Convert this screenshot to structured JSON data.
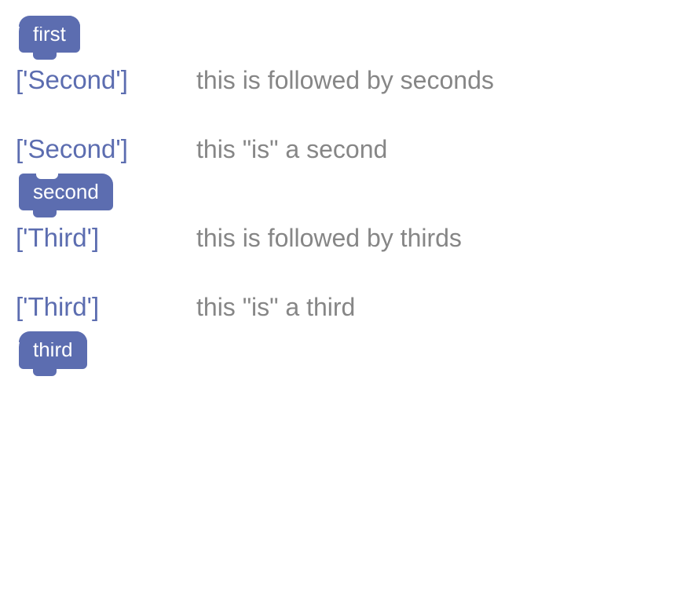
{
  "groups": [
    {
      "block_label": "first",
      "block_style": "hat round",
      "tokens": "['Second']",
      "desc": "this is followed by seconds"
    },
    {
      "intro_tokens": "['Second']",
      "intro_desc": "this \"is\" a second",
      "block_label": "second",
      "block_style": "notch-top",
      "tokens": "['Third']",
      "desc": "this is followed by thirds"
    },
    {
      "intro_tokens": "['Third']",
      "intro_desc": "this \"is\" a third",
      "block_label": "third",
      "block_style": "hat round",
      "tokens": null,
      "desc": null
    }
  ]
}
